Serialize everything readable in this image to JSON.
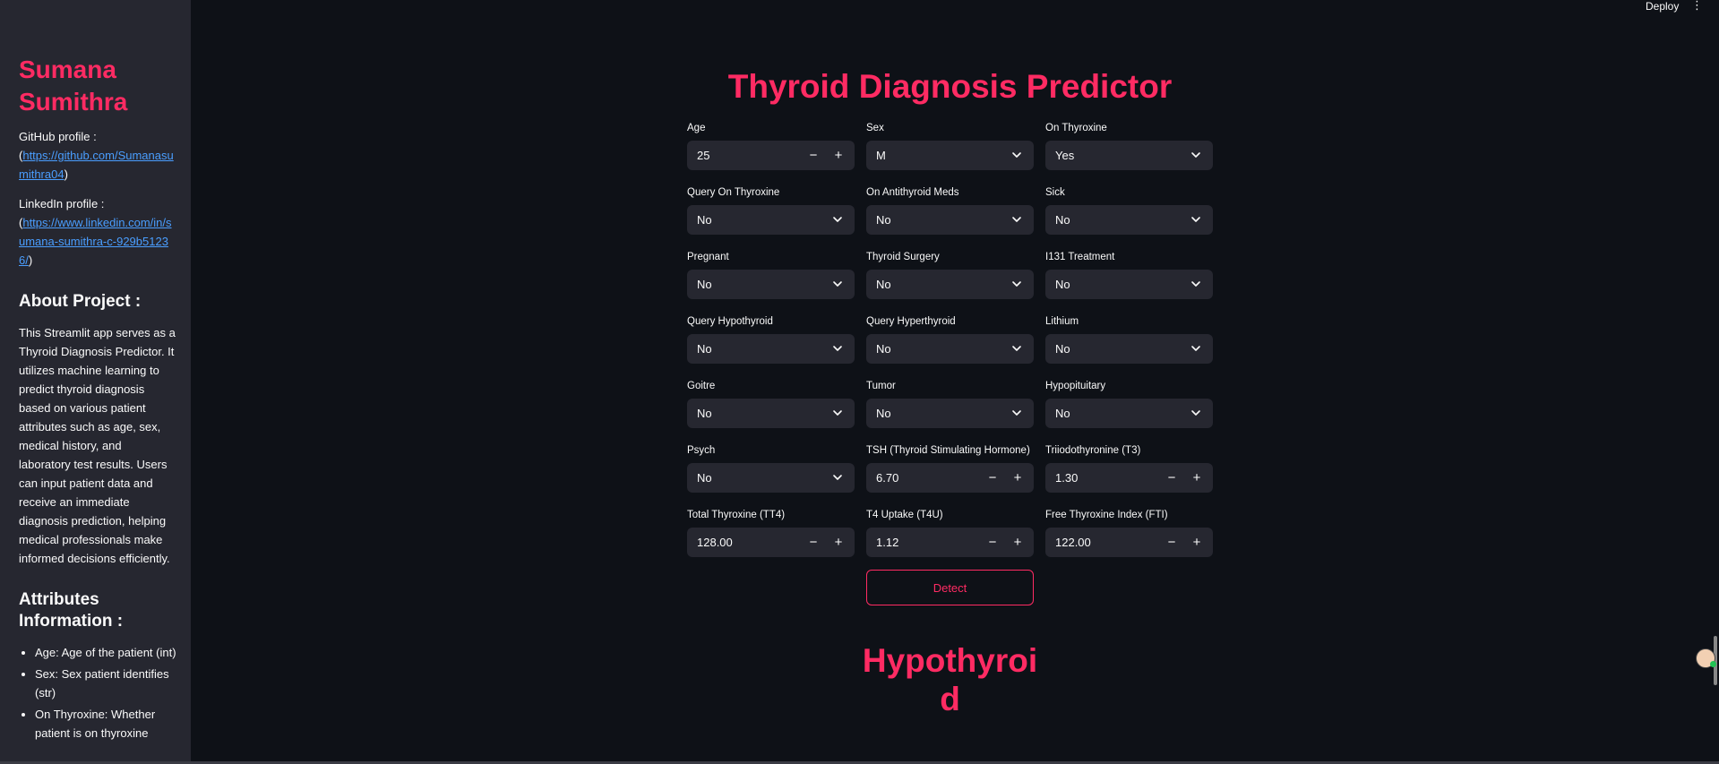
{
  "sidebar": {
    "name": "Sumana Sumithra",
    "github_label": "GitHub profile :",
    "github_prefix": "(",
    "github_url": "https://github.com/Sumanasumithra04",
    "github_suffix": ")",
    "linkedin_label": "LinkedIn profile :",
    "linkedin_prefix": "(",
    "linkedin_url": "https://www.linkedin.com/in/sumana-sumithra-c-929b51236/",
    "linkedin_suffix": ")",
    "about_heading": "About Project :",
    "about_text": "This Streamlit app serves as a Thyroid Diagnosis Predictor. It utilizes machine learning to predict thyroid diagnosis based on various patient attributes such as age, sex, medical history, and laboratory test results. Users can input patient data and receive an immediate diagnosis prediction, helping medical professionals make informed decisions efficiently.",
    "attributes_heading": "Attributes Information :",
    "attributes": [
      "Age: Age of the patient (int)",
      "Sex: Sex patient identifies (str)",
      "On Thyroxine: Whether patient is on thyroxine"
    ]
  },
  "header": {
    "deploy_label": "Deploy",
    "menu_icon": "vertical-dots-icon"
  },
  "main": {
    "title": "Thyroid Diagnosis Predictor",
    "fields": [
      {
        "label": "Age",
        "value": "25",
        "kind": "number"
      },
      {
        "label": "Sex",
        "value": "M",
        "kind": "select"
      },
      {
        "label": "On Thyroxine",
        "value": "Yes",
        "kind": "select"
      },
      {
        "label": "Query On Thyroxine",
        "value": "No",
        "kind": "select"
      },
      {
        "label": "On Antithyroid Meds",
        "value": "No",
        "kind": "select"
      },
      {
        "label": "Sick",
        "value": "No",
        "kind": "select"
      },
      {
        "label": "Pregnant",
        "value": "No",
        "kind": "select"
      },
      {
        "label": "Thyroid Surgery",
        "value": "No",
        "kind": "select"
      },
      {
        "label": "I131 Treatment",
        "value": "No",
        "kind": "select"
      },
      {
        "label": "Query Hypothyroid",
        "value": "No",
        "kind": "select"
      },
      {
        "label": "Query Hyperthyroid",
        "value": "No",
        "kind": "select"
      },
      {
        "label": "Lithium",
        "value": "No",
        "kind": "select"
      },
      {
        "label": "Goitre",
        "value": "No",
        "kind": "select"
      },
      {
        "label": "Tumor",
        "value": "No",
        "kind": "select"
      },
      {
        "label": "Hypopituitary",
        "value": "No",
        "kind": "select"
      },
      {
        "label": "Psych",
        "value": "No",
        "kind": "select"
      },
      {
        "label": "TSH (Thyroid Stimulating Hormone)",
        "value": "6.70",
        "kind": "number"
      },
      {
        "label": "Triiodothyronine (T3)",
        "value": "1.30",
        "kind": "number"
      },
      {
        "label": "Total Thyroxine (TT4)",
        "value": "128.00",
        "kind": "number"
      },
      {
        "label": "T4 Uptake (T4U)",
        "value": "1.12",
        "kind": "number"
      },
      {
        "label": "Free Thyroxine Index (FTI)",
        "value": "122.00",
        "kind": "number"
      }
    ],
    "minus_symbol": "−",
    "plus_symbol": "+",
    "detect_label": "Detect",
    "result": "Hypothyroid"
  },
  "colors": {
    "accent": "#ff2b63",
    "background": "#0e1117",
    "sidebar": "#262730",
    "link": "#4a9eff"
  }
}
